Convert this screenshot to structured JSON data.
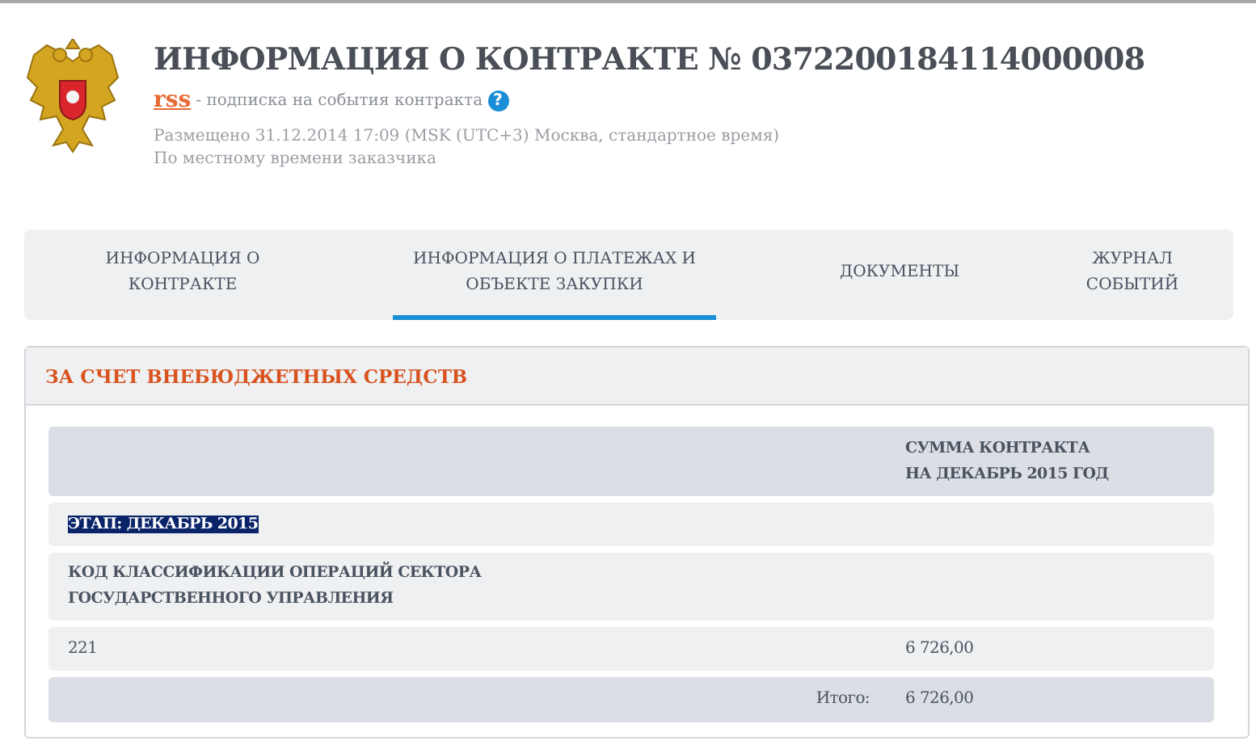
{
  "header": {
    "title": "ИНФОРМАЦИЯ О КОНТРАКТЕ № 0372200184114000008",
    "rss_link": "rss",
    "rss_caption": "- подписка на события контракта",
    "help": "?",
    "posted": "Размещено 31.12.2014 17:09 (MSK (UTC+3) Москва, стандартное время)",
    "local_time_note": "По местному времени заказчика"
  },
  "tabs": [
    {
      "label": "ИНФОРМАЦИЯ О КОНТРАКТЕ",
      "selected": false
    },
    {
      "label": "ИНФОРМАЦИЯ О ПЛАТЕЖАХ И ОБЪЕКТЕ ЗАКУПКИ",
      "selected": true
    },
    {
      "label": "ДОКУМЕНТЫ",
      "selected": false
    },
    {
      "label": "ЖУРНАЛ СОБЫТИЙ",
      "selected": false
    }
  ],
  "section": {
    "title": "ЗА СЧЕТ ВНЕБЮДЖЕТНЫХ СРЕДСТВ",
    "table": {
      "amount_heading": "СУММА КОНТРАКТА НА ДЕКАБРЬ 2015 ГОД",
      "stage": {
        "label": "ЭТАП: ДЕКАБРЬ 2015",
        "text_selected": true
      },
      "code_heading": "КОД КЛАССИФИКАЦИИ ОПЕРАЦИЙ СЕКТОРА ГОСУДАРСТВЕННОГО УПРАВЛЕНИЯ",
      "rows": [
        {
          "code": "221",
          "amount": "6 726,00"
        }
      ],
      "total": {
        "label": "Итого:",
        "amount": "6 726,00"
      }
    }
  }
}
